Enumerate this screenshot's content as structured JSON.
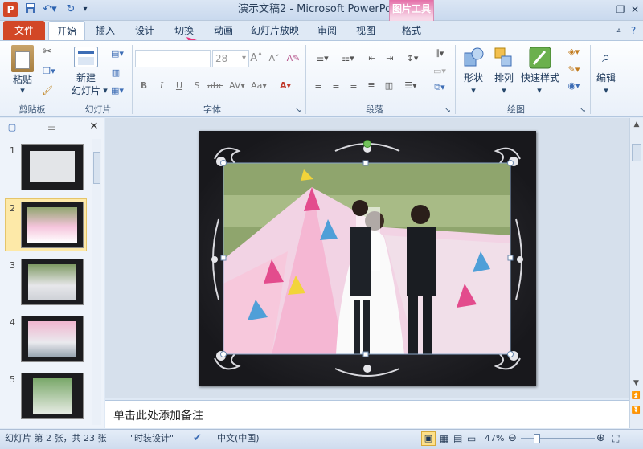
{
  "window": {
    "title": "演示文稿2 - Microsoft PowerPoint",
    "app_logo": "P",
    "context_group": "图片工具"
  },
  "tabs": [
    "文件",
    "开始",
    "插入",
    "设计",
    "切换",
    "动画",
    "幻灯片放映",
    "审阅",
    "视图",
    "格式"
  ],
  "ribbon": {
    "clipboard": {
      "paste": "粘贴",
      "group": "剪贴板"
    },
    "slides": {
      "new_slide_line1": "新建",
      "new_slide_line2": "幻灯片",
      "group": "幻灯片"
    },
    "font": {
      "size": "28",
      "group": "字体",
      "bold": "B",
      "italic": "I",
      "underline": "U",
      "strike": "abc",
      "shadow": "S"
    },
    "paragraph": {
      "group": "段落"
    },
    "drawing": {
      "shapes": "形状",
      "arrange": "排列",
      "quick_styles": "快速样式",
      "group": "绘图"
    },
    "editing": {
      "edit": "编辑"
    }
  },
  "thumbnails": [
    "1",
    "2",
    "3",
    "4",
    "5"
  ],
  "notes_placeholder": "单击此处添加备注",
  "status": {
    "slide_info": "幻灯片 第 2 张，共 23 张",
    "theme": "\"时装设计\"",
    "language": "中文(中国)",
    "zoom": "47%"
  },
  "colors": {
    "file_tab": "#d24726",
    "context_tab": "#e46fa8",
    "arrow": "#e8337a"
  }
}
